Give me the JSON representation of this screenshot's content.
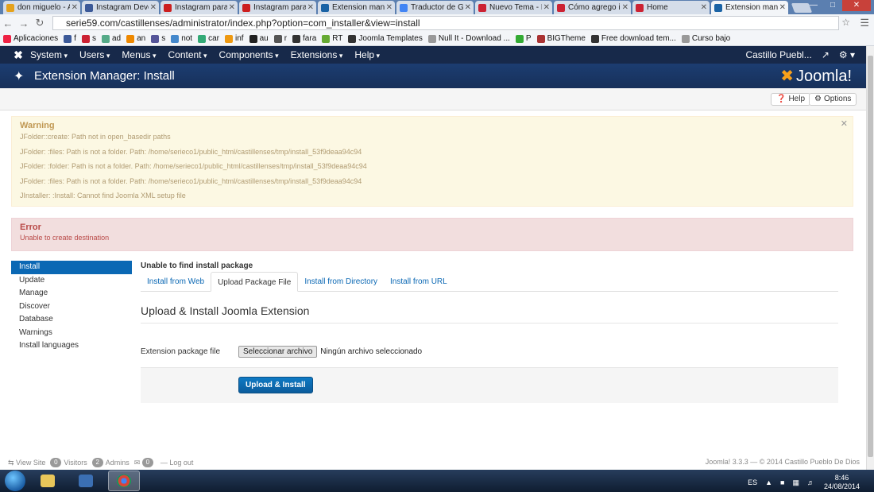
{
  "browser": {
    "tabs": [
      {
        "label": "don miguelo - A",
        "color": "#e5a21c"
      },
      {
        "label": "Instagram Devel",
        "color": "#3b5998"
      },
      {
        "label": "Instagram para J",
        "color": "#cc1f1f"
      },
      {
        "label": "Instagram para J",
        "color": "#cc1f1f"
      },
      {
        "label": "Extension mana",
        "color": "#1b63a5"
      },
      {
        "label": "Traductor de Go",
        "color": "#4285f4"
      },
      {
        "label": "Nuevo Tema - H",
        "color": "#c23"
      },
      {
        "label": "Cómo agrego in",
        "color": "#c23"
      },
      {
        "label": "Home",
        "color": "#c23"
      },
      {
        "label": "Extension mana",
        "color": "#1b63a5",
        "active": true
      }
    ],
    "url": "serie59.com/castillenses/administrator/index.php?option=com_installer&view=install",
    "bookmarks": [
      {
        "label": "Aplicaciones",
        "color": "#e24"
      },
      {
        "label": "f",
        "color": "#3b5998"
      },
      {
        "label": "s",
        "color": "#c23"
      },
      {
        "label": "ad",
        "color": "#5a8"
      },
      {
        "label": "an",
        "color": "#e80"
      },
      {
        "label": "s",
        "color": "#559"
      },
      {
        "label": "not",
        "color": "#48c"
      },
      {
        "label": "car",
        "color": "#3a7"
      },
      {
        "label": "inf",
        "color": "#e91"
      },
      {
        "label": "au",
        "color": "#222"
      },
      {
        "label": "r",
        "color": "#555"
      },
      {
        "label": "fara",
        "color": "#333"
      },
      {
        "label": "RT",
        "color": "#6a3"
      },
      {
        "label": "Joomla Templates",
        "color": "#333"
      },
      {
        "label": "Null It - Download ...",
        "color": "#999"
      },
      {
        "label": "P",
        "color": "#3a3"
      },
      {
        "label": "BIGTheme",
        "color": "#a33"
      },
      {
        "label": "Free download tem...",
        "color": "#333"
      },
      {
        "label": "Curso bajo",
        "color": "#999"
      }
    ]
  },
  "joomla": {
    "menu": [
      "System",
      "Users",
      "Menus",
      "Content",
      "Components",
      "Extensions",
      "Help"
    ],
    "site_name": "Castillo Puebl...",
    "page_title": "Extension Manager: Install",
    "brand": "Joomla!",
    "toolbar": {
      "help": "Help",
      "options": "Options"
    },
    "warning": {
      "title": "Warning",
      "lines": [
        "JFolder::create: Path not in open_basedir paths",
        "JFolder: :files: Path is not a folder. Path: /home/serieco1/public_html/castillenses/tmp/install_53f9deaa94c94",
        "JFolder: :folder: Path is not a folder. Path: /home/serieco1/public_html/castillenses/tmp/install_53f9deaa94c94",
        "JFolder: :files: Path is not a folder. Path: /home/serieco1/public_html/castillenses/tmp/install_53f9deaa94c94",
        "JInstaller: :Install: Cannot find Joomla XML setup file"
      ]
    },
    "error": {
      "title": "Error",
      "message": "Unable to create destination"
    },
    "sidebar": [
      "Install",
      "Update",
      "Manage",
      "Discover",
      "Database",
      "Warnings",
      "Install languages"
    ],
    "main": {
      "notice": "Unable to find install package",
      "tabs": [
        "Install from Web",
        "Upload Package File",
        "Install from Directory",
        "Install from URL"
      ],
      "active_tab": 1,
      "heading": "Upload & Install Joomla Extension",
      "field_label": "Extension package file",
      "file_button": "Seleccionar archivo",
      "file_status": "Ningún archivo seleccionado",
      "submit": "Upload & Install"
    },
    "status": {
      "view_site": "View Site",
      "visitors_count": "0",
      "visitors": "Visitors",
      "admins_count": "2",
      "admins": "Admins",
      "messages_count": "0",
      "logout": "Log out",
      "copyright": "Joomla! 3.3.3 — © 2014 Castillo Pueblo De Dios"
    }
  },
  "taskbar": {
    "lang": "ES",
    "time": "8:46",
    "date": "24/08/2014"
  }
}
